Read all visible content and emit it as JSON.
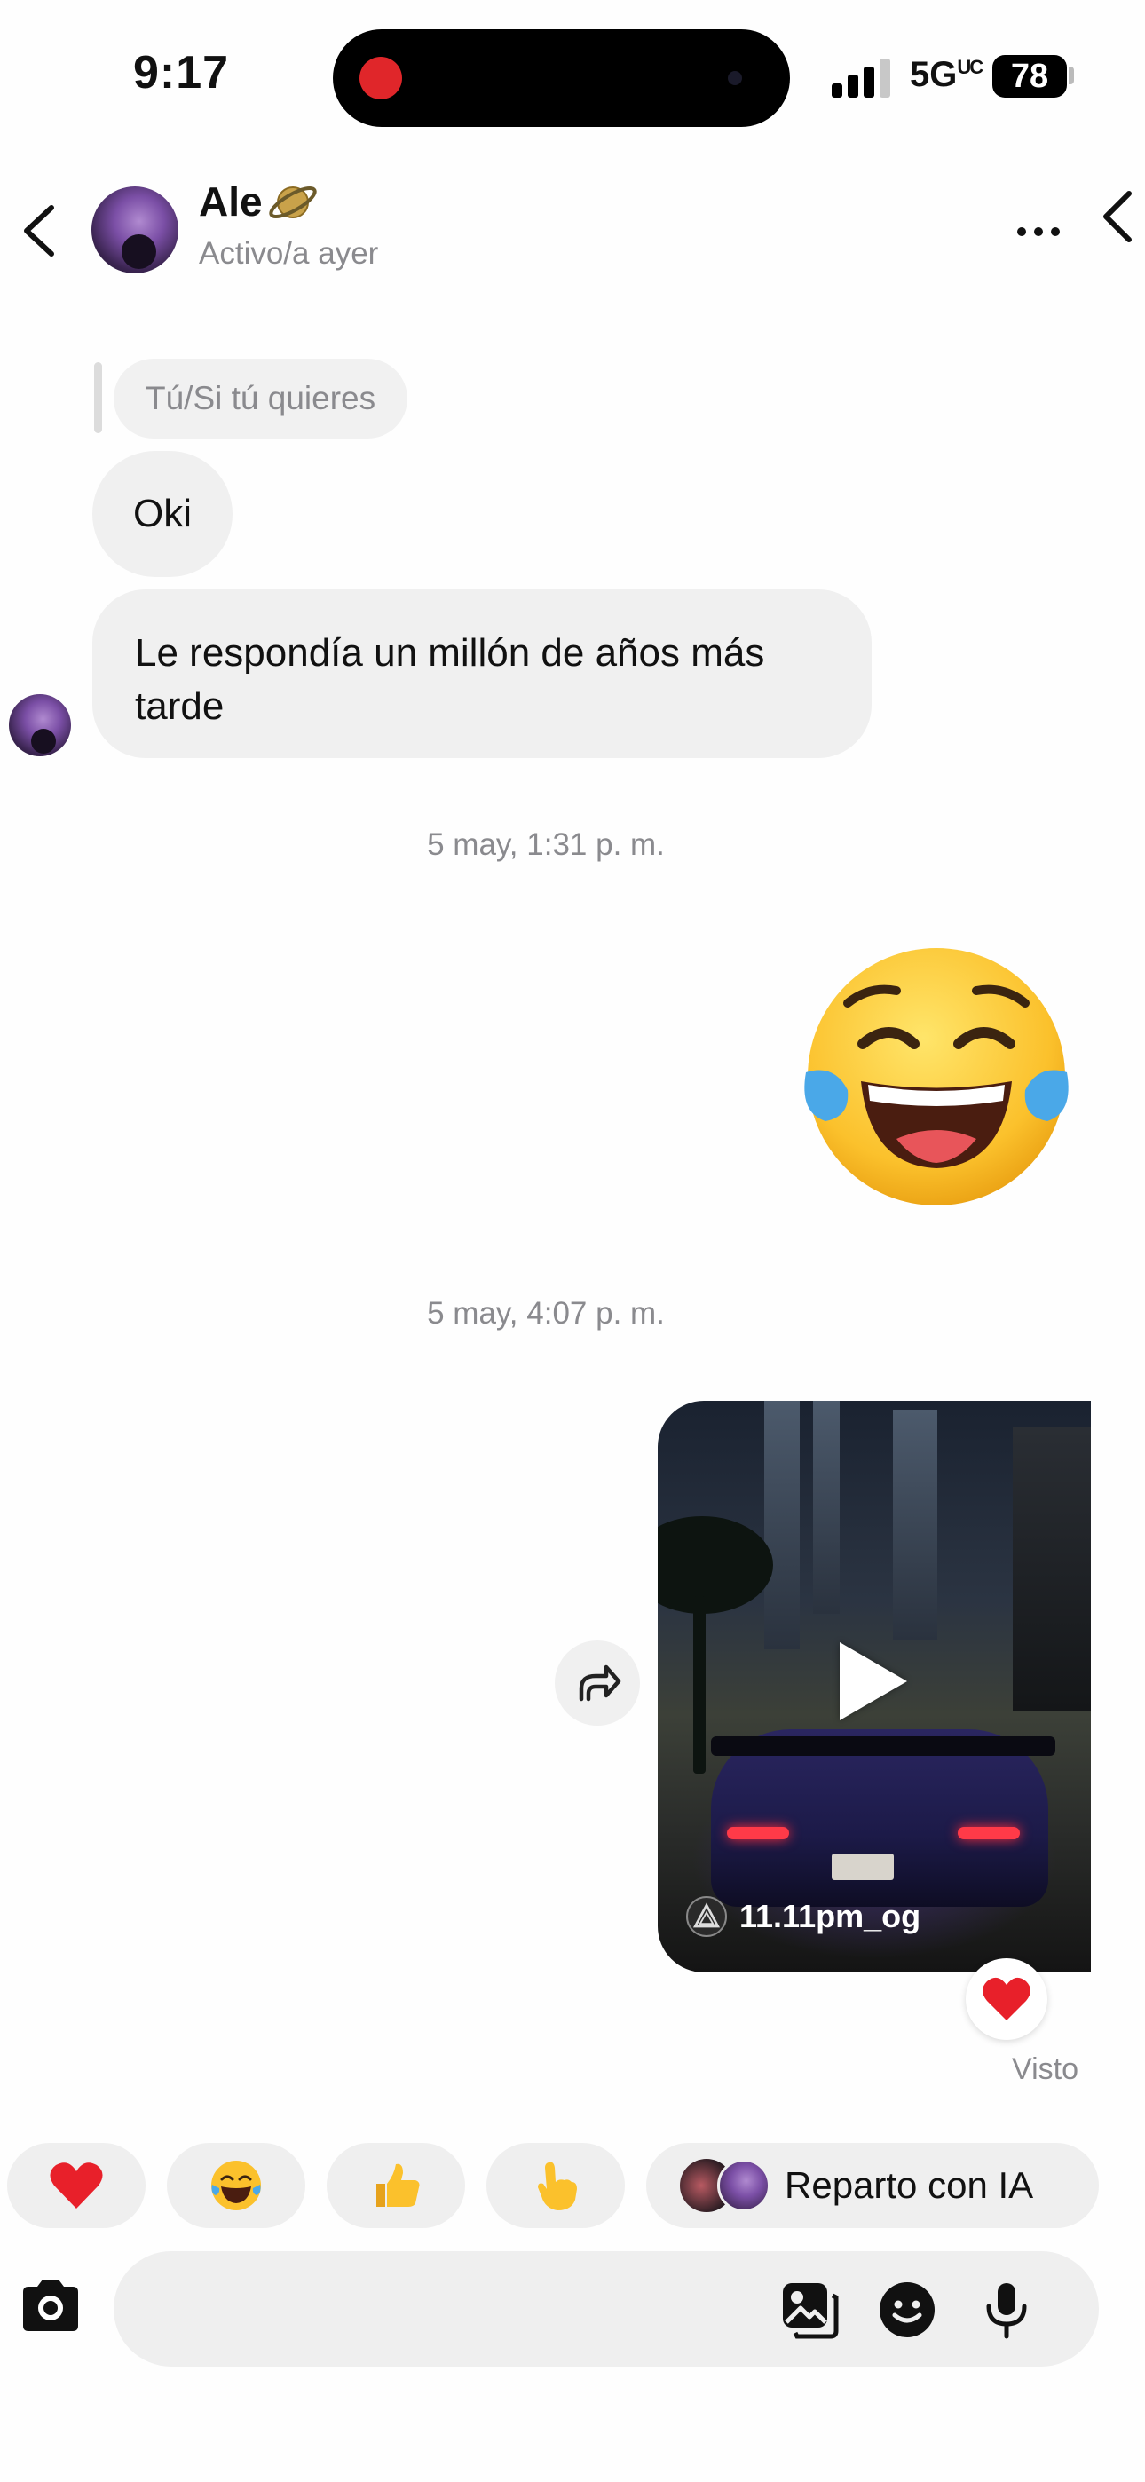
{
  "status_bar": {
    "time": "9:17",
    "network": "5G",
    "network_suffix": "UC",
    "battery": "78"
  },
  "header": {
    "contact_name": "Ale",
    "contact_status": "Activo/a ayer",
    "name_emoji_icon": "ringed-planet-icon"
  },
  "messages": {
    "reply_quote": "Tú/Si tú quieres",
    "incoming_1": "Oki",
    "incoming_2": "Le respondía un millón de años más tarde",
    "timestamp_1": "5 may, 1:31 p. m.",
    "outgoing_emoji": "face-with-tears-of-joy",
    "timestamp_2": "5 may, 4:07 p. m.",
    "video_username": "11.11pm_og",
    "reaction_on_video": "heart",
    "seen_label": "Visto"
  },
  "quick_reactions": {
    "items": [
      "heart",
      "face-with-tears-of-joy",
      "thumbs-up",
      "pointing-hand"
    ],
    "ai_label": "Reparto con IA"
  },
  "colors": {
    "bubble_incoming": "#f0f0f0",
    "meta_text": "#8a8a8e",
    "record_dot": "#e0262a",
    "heart": "#e8202a"
  }
}
